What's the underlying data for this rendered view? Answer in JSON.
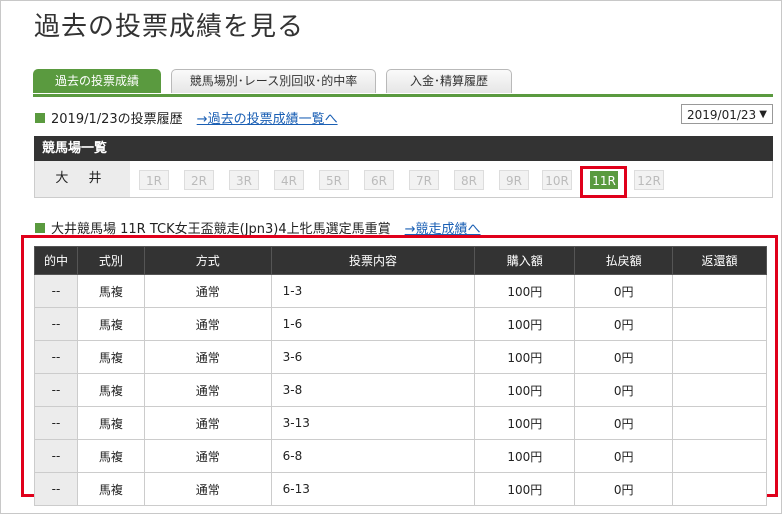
{
  "page": {
    "title": "過去の投票成績を見る"
  },
  "tabs": [
    {
      "label": "過去の投票成績",
      "active": true
    },
    {
      "label": "競馬場別･レース別回収･的中率",
      "active": false
    },
    {
      "label": "入金･精算履歴",
      "active": false
    }
  ],
  "history": {
    "heading": "2019/1/23の投票履歴",
    "link": "→過去の投票成績一覧へ",
    "date_value": "2019/01/23",
    "date_arrow": "▼"
  },
  "venues": {
    "header": "競馬場一覧",
    "name": "大 井",
    "races": [
      "1R",
      "2R",
      "3R",
      "4R",
      "5R",
      "6R",
      "7R",
      "8R",
      "9R",
      "10R",
      "11R",
      "12R"
    ],
    "selected_race": "11R"
  },
  "race": {
    "heading": "大井競馬場 11R TCK女王盃競走(Jpn3)4上牝馬選定馬重賞",
    "link": "→競走成績へ"
  },
  "table": {
    "columns": [
      "的中",
      "式別",
      "方式",
      "投票内容",
      "購入額",
      "払戻額",
      "返還額"
    ],
    "rows": [
      [
        "--",
        "馬複",
        "通常",
        "1-3",
        "100円",
        "0円",
        ""
      ],
      [
        "--",
        "馬複",
        "通常",
        "1-6",
        "100円",
        "0円",
        ""
      ],
      [
        "--",
        "馬複",
        "通常",
        "3-6",
        "100円",
        "0円",
        ""
      ],
      [
        "--",
        "馬複",
        "通常",
        "3-8",
        "100円",
        "0円",
        ""
      ],
      [
        "--",
        "馬複",
        "通常",
        "3-13",
        "100円",
        "0円",
        ""
      ],
      [
        "--",
        "馬複",
        "通常",
        "6-8",
        "100円",
        "0円",
        ""
      ],
      [
        "--",
        "馬複",
        "通常",
        "6-13",
        "100円",
        "0円",
        ""
      ]
    ]
  }
}
